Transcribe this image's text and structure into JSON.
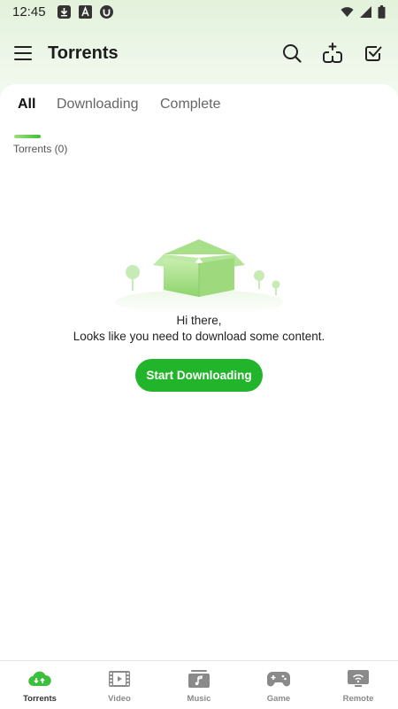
{
  "status_bar": {
    "time": "12:45",
    "icons": [
      "download-notification-icon",
      "font-app-icon",
      "utorrent-icon"
    ],
    "right_icons": [
      "wifi-icon",
      "cell-signal-icon",
      "battery-icon"
    ]
  },
  "app_bar": {
    "title": "Torrents",
    "icons": [
      "menu-icon",
      "search-icon",
      "add-torrent-icon",
      "select-check-icon"
    ]
  },
  "tabs": [
    {
      "label": "All",
      "active": true
    },
    {
      "label": "Downloading",
      "active": false
    },
    {
      "label": "Complete",
      "active": false
    }
  ],
  "torrents_count_label": "Torrents (0)",
  "empty_state": {
    "line1": "Hi there,",
    "line2": "Looks like you need to download some content.",
    "button_label": "Start Downloading"
  },
  "bottom_nav": [
    {
      "label": "Torrents",
      "icon": "cloud-download-icon",
      "active": true
    },
    {
      "label": "Video",
      "icon": "film-icon",
      "active": false
    },
    {
      "label": "Music",
      "icon": "music-icon",
      "active": false
    },
    {
      "label": "Game",
      "icon": "gamepad-icon",
      "active": false
    },
    {
      "label": "Remote",
      "icon": "remote-icon",
      "active": false
    }
  ],
  "colors": {
    "accent": "#22b52b",
    "header_bg": "#e3f2db",
    "tab_indicator": "#3fbf3a"
  }
}
